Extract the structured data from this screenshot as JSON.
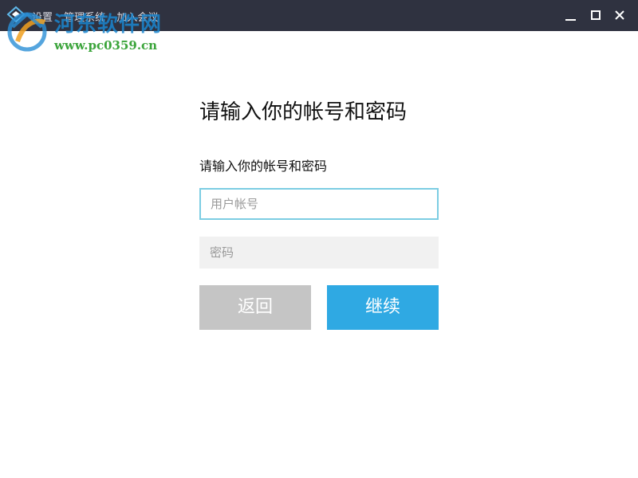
{
  "window": {
    "title_parts": [
      "设置",
      "管理系统",
      "加入会议"
    ],
    "controls": {
      "minimize_icon": "minimize-icon",
      "maximize_icon": "maximize-icon",
      "close_icon": "close-icon"
    }
  },
  "watermark": {
    "name": "河东软件网",
    "url": "www.pc0359.cn"
  },
  "form": {
    "heading": "请输入你的帐号和密码",
    "subheading": "请输入你的帐号和密码",
    "account": {
      "placeholder": "用户帐号",
      "value": ""
    },
    "password": {
      "placeholder": "密码",
      "value": ""
    },
    "back_label": "返回",
    "continue_label": "继续"
  },
  "colors": {
    "titlebar": "#2f3240",
    "focus_border": "#7ccde3",
    "primary_button": "#2fa9e3",
    "secondary_button": "#c5c5c5",
    "input_fill": "#f1f1f1"
  }
}
